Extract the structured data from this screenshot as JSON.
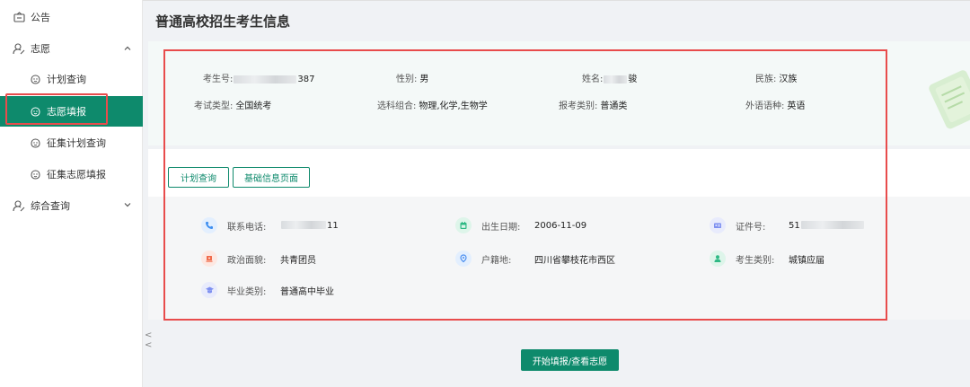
{
  "sidebar": {
    "notice": "公告",
    "wish": "志愿",
    "plan_query": "计划查询",
    "wish_fill": "志愿填报",
    "collect_plan_query": "征集计划查询",
    "collect_wish_fill": "征集志愿填报",
    "general_query": "综合查询",
    "collapse_glyph": "<<"
  },
  "page": {
    "title": "普通高校招生考生信息"
  },
  "student": {
    "exam_no_label": "考生号:",
    "exam_no_suffix": "387",
    "gender_label": "性别:",
    "gender": "男",
    "name_label": "姓名:",
    "name_suffix": "骏",
    "ethnic_label": "民族:",
    "ethnic": "汉族",
    "exam_type_label": "考试类型:",
    "exam_type": "全国统考",
    "subjects_label": "选科组合:",
    "subjects": "物理,化学,生物学",
    "apply_type_label": "报考类别:",
    "apply_type": "普通类",
    "language_label": "外语语种:",
    "language": "英语"
  },
  "buttons": {
    "plan_query": "计划查询",
    "basic_info": "基础信息页面",
    "start": "开始填报/查看志愿"
  },
  "details": {
    "phone_label": "联系电话:",
    "phone_suffix": "11",
    "birth_label": "出生日期:",
    "birth": "2006-11-09",
    "id_label": "证件号:",
    "id_prefix": "51",
    "political_label": "政治面貌:",
    "political": "共青团员",
    "hukou_label": "户籍地:",
    "hukou": "四川省攀枝花市西区",
    "category_label": "考生类别:",
    "category": "城镇应届",
    "grad_label": "毕业类别:",
    "grad": "普通高中毕业"
  },
  "colors": {
    "brand": "#0e8a6c",
    "highlight": "#e84c4c",
    "phone_icon": "#3d8ef0",
    "birth_icon": "#2fb985",
    "id_icon": "#7d8ff0",
    "political_icon": "#f06a4a",
    "hukou_icon": "#4a8ef0",
    "category_icon": "#2fb985",
    "grad_icon": "#7d8ff0"
  },
  "icons": {
    "notice": "notice-icon",
    "wish": "user-edit-icon",
    "sub": "smile-icon",
    "general_query": "user-search-icon",
    "phone": "phone-icon",
    "birth": "calendar-icon",
    "id": "id-card-icon",
    "political": "flag-icon",
    "hukou": "location-icon",
    "category": "person-icon",
    "grad": "graduation-cap-icon"
  }
}
